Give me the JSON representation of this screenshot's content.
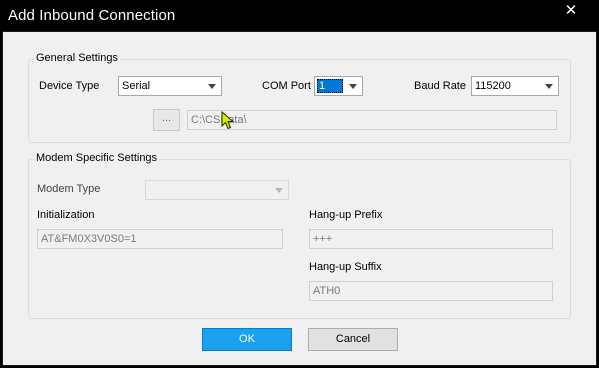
{
  "window": {
    "title": "Add Inbound Connection",
    "close_glyph": "✕"
  },
  "general": {
    "group_label": "General Settings",
    "device_type": {
      "label": "Device Type",
      "value": "Serial"
    },
    "com_port": {
      "label": "COM Port",
      "value": "1"
    },
    "baud_rate": {
      "label": "Baud Rate",
      "value": "115200"
    },
    "browse_label": "...",
    "path_value": "C:\\CSData\\"
  },
  "modem": {
    "group_label": "Modem Specific Settings",
    "modem_type": {
      "label": "Modem Type",
      "value": ""
    },
    "initialization": {
      "label": "Initialization",
      "value": "AT&FM0X3V0S0=1"
    },
    "hangup_prefix": {
      "label": "Hang-up Prefix",
      "value": "+++"
    },
    "hangup_suffix": {
      "label": "Hang-up Suffix",
      "value": "ATH0"
    }
  },
  "buttons": {
    "ok": "OK",
    "cancel": "Cancel"
  },
  "colors": {
    "accent": "#1aa2f0",
    "selection": "#0078d7",
    "title_bar": "#000000"
  },
  "icons": {
    "close": "close-icon",
    "dropdown": "chevron-down-icon",
    "cursor": "mouse-pointer-icon"
  }
}
